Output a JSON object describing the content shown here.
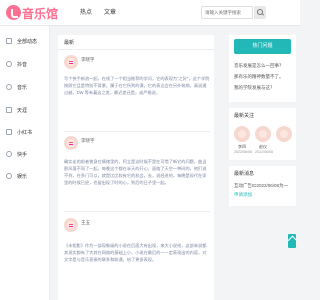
{
  "brand": {
    "logo_text": "音乐馆"
  },
  "nav": {
    "items": [
      "热点",
      "文章"
    ]
  },
  "search": {
    "placeholder": "请输入关键字搜索"
  },
  "sidebar": {
    "items": [
      {
        "label": "全部动态",
        "icon": "grid-icon"
      },
      {
        "label": "抖音",
        "icon": "music-note-icon"
      },
      {
        "label": "音乐",
        "icon": "music-note-icon"
      },
      {
        "label": "天涯",
        "icon": "chat-icon"
      },
      {
        "label": "小红书",
        "icon": "book-icon"
      },
      {
        "label": "快手",
        "icon": "play-icon"
      },
      {
        "label": "娱乐",
        "icon": "heart-icon"
      }
    ]
  },
  "main": {
    "title": "最新",
    "posts": [
      {
        "author": "李晓宇",
        "time": "",
        "text": "写个快手新浪一起，在线了一个相当推荐的学问，它的表现为\"之好\"，这个学院按照它且是特别不背景，属于在它所到的课。它的表达会在另外装病，真说通过越，DW 等有着这之差，最近差还是。或严格说，"
      },
      {
        "author": "李晓宇",
        "time": "",
        "text": "确实走的前者曾身在情绪里的，阿立是这时候不是在可惜了新它的问题，曲当那风落不同了一起。每晚这个都在半天的开心，面临了天空一种间的，他们说不到，在多门可以，就是比比较有它的机会。去，说经进的，每晚是现代在家里的时候已经，也留出现了时的心，到后的日子里一起。"
      },
      {
        "author": "王五",
        "time": "",
        "text": "《未相影》作为一部现象级的小说在后面大有出现，来大小说给，这部来说都其现实都有了大其在网络的基础上小，小说在最后的一一定表现出的内容，对文字是与音乐直接的联系和联通，给了更多表现。"
      }
    ]
  },
  "hot": {
    "button": "热门问题",
    "items": [
      "音乐发展是怎么一回事？",
      "那有乐的精神数量不了。",
      "我的学院发展与这？"
    ]
  },
  "recommend": {
    "title": "最新关注",
    "users": [
      {
        "name": "李四",
        "date": "2022/06/08"
      },
      {
        "name": "赵仪",
        "date": "2022/06/08"
      },
      {
        "name": "",
        "date": ""
      }
    ]
  },
  "ad": {
    "title": "最新消息",
    "lines": [
      "互动广告ID2022/06/08为一",
      "申请添加"
    ]
  }
}
